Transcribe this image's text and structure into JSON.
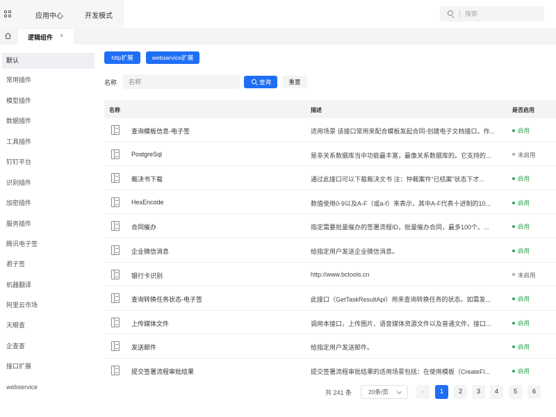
{
  "topbar": {
    "nav": [
      {
        "label": "应用中心"
      },
      {
        "label": "开发模式"
      }
    ],
    "search_placeholder": "搜索"
  },
  "tabs": [
    {
      "label": "逻辑组件",
      "close": "×"
    }
  ],
  "sidebar": {
    "items": [
      {
        "label": "默认"
      },
      {
        "label": "常用插件"
      },
      {
        "label": "模型插件"
      },
      {
        "label": "数据插件"
      },
      {
        "label": "工具插件"
      },
      {
        "label": "钉钉平台"
      },
      {
        "label": "识别插件"
      },
      {
        "label": "加密插件"
      },
      {
        "label": "服务插件"
      },
      {
        "label": "腾讯电子签"
      },
      {
        "label": "君子签"
      },
      {
        "label": "机器翻译"
      },
      {
        "label": "阿里云市场"
      },
      {
        "label": "天眼查"
      },
      {
        "label": "企查查"
      },
      {
        "label": "接口扩展"
      },
      {
        "label": "webservice"
      }
    ],
    "active_index": 0
  },
  "main": {
    "type_buttons": [
      {
        "label": "http扩展"
      },
      {
        "label": "webservice扩展"
      }
    ],
    "filter": {
      "label": "名称",
      "placeholder": "名称",
      "query_label": "查询",
      "reset_label": "重置"
    },
    "table": {
      "headers": {
        "name": "名称",
        "desc": "描述",
        "enabled": "是否启用"
      },
      "rows": [
        {
          "name": "查询模板信息-电子签",
          "desc": "适用场景 该接口常用来配合模板发起合同-创建电子文档接口，作...",
          "status": "启用",
          "on": true
        },
        {
          "name": "PostgreSql",
          "desc": "是非关系数据库当中功能最丰富，最像关系数据库的。它支持的...",
          "status": "未启用",
          "on": false
        },
        {
          "name": "裁决书下载",
          "desc": "通过此接口可以下载裁决文书 注：仲裁案件“已结案”状态下才...",
          "status": "启用",
          "on": true
        },
        {
          "name": "HexEncode",
          "desc": "数值使用0-9以及A-F（或a-f）来表示，其中A-F代表十进制的10...",
          "status": "启用",
          "on": true
        },
        {
          "name": "合同催办",
          "desc": "指定需要批量催办的签署流程ID，批量催办合同，最多100个。...",
          "status": "启用",
          "on": true
        },
        {
          "name": "企业微信消息",
          "desc": "给指定用户发送企业微信消息。",
          "status": "启用",
          "on": true
        },
        {
          "name": "银行卡识别",
          "desc": "http://www.bctools.cn",
          "status": "未启用",
          "on": false
        },
        {
          "name": "查询转换任务状态-电子签",
          "desc": "此接口（GetTaskResultApi）用来查询转换任务的状态。如需发...",
          "status": "启用",
          "on": true
        },
        {
          "name": "上传媒体文件",
          "desc": "调用本接口，上传图片、语音媒体资源文件以及普通文件，接口...",
          "status": "启用",
          "on": true
        },
        {
          "name": "发送邮件",
          "desc": "给指定用户发送邮件。",
          "status": "启用",
          "on": true
        },
        {
          "name": "提交签署流程审批结果",
          "desc": "提交签署流程审批结果的适用场景包括：在使用模板（CreateFl...",
          "status": "启用",
          "on": true
        }
      ]
    },
    "pagination": {
      "total_label": "共 241 条",
      "page_size": "20条/页",
      "prev": "‹",
      "pages": [
        "1",
        "2",
        "3",
        "4",
        "5",
        "6"
      ],
      "current": "1"
    }
  },
  "colors": {
    "primary": "#1f6ff5",
    "enabled": "#2ea44f",
    "disabled_dot": "#aaaaaa"
  },
  "icons": {
    "app_switcher": "grid-icon",
    "search": "search-icon",
    "home": "home-icon",
    "row": "document-icon"
  }
}
